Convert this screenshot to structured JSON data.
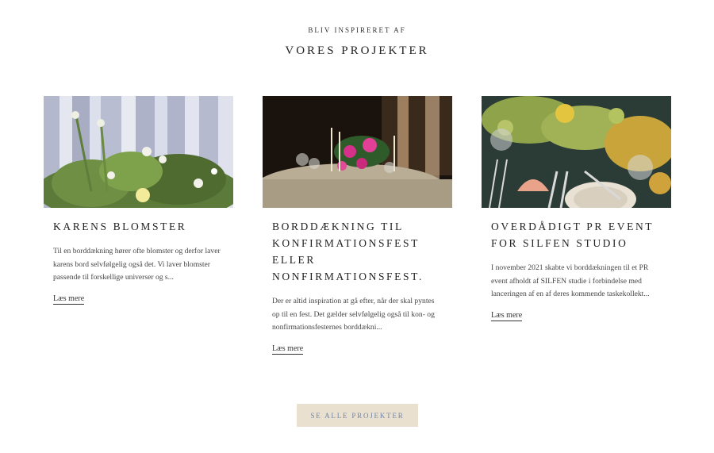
{
  "section": {
    "eyebrow": "BLIV INSPIRERET AF",
    "title": "VORES PROJEKTER"
  },
  "projects": [
    {
      "title": "KARENS BLOMSTER",
      "excerpt": "Til en borddækning hører ofte blomster og derfor laver karens bord selvfølgelig også det. Vi laver blomster passende til forskellige universer og s...",
      "link": "Læs mere",
      "image": "flower-arrangement-photo"
    },
    {
      "title": "BORDDÆKNING TIL KONFIRMATIONSFEST ELLER NONFIRMATIONSFEST.",
      "excerpt": "Der er altid inspiration at gå efter, når der skal pyntes op til en fest. Det gælder selvfølgelig også til kon- og nonfirmationsfesternes borddækni...",
      "link": "Læs mere",
      "image": "table-setting-photo"
    },
    {
      "title": "OVERDÅDIGT PR EVENT FOR SILFEN STUDIO",
      "excerpt": "I november 2021 skabte vi borddækningen til et PR event afholdt af SILFEN studie i forbindelse med lanceringen af en af deres kommende taskekollekt...",
      "link": "Læs mere",
      "image": "pr-event-photo"
    }
  ],
  "cta": {
    "label": "SE ALLE PROJEKTER"
  },
  "colors": {
    "cta_bg": "#e9e0d0",
    "cta_text": "#6f86a8"
  }
}
